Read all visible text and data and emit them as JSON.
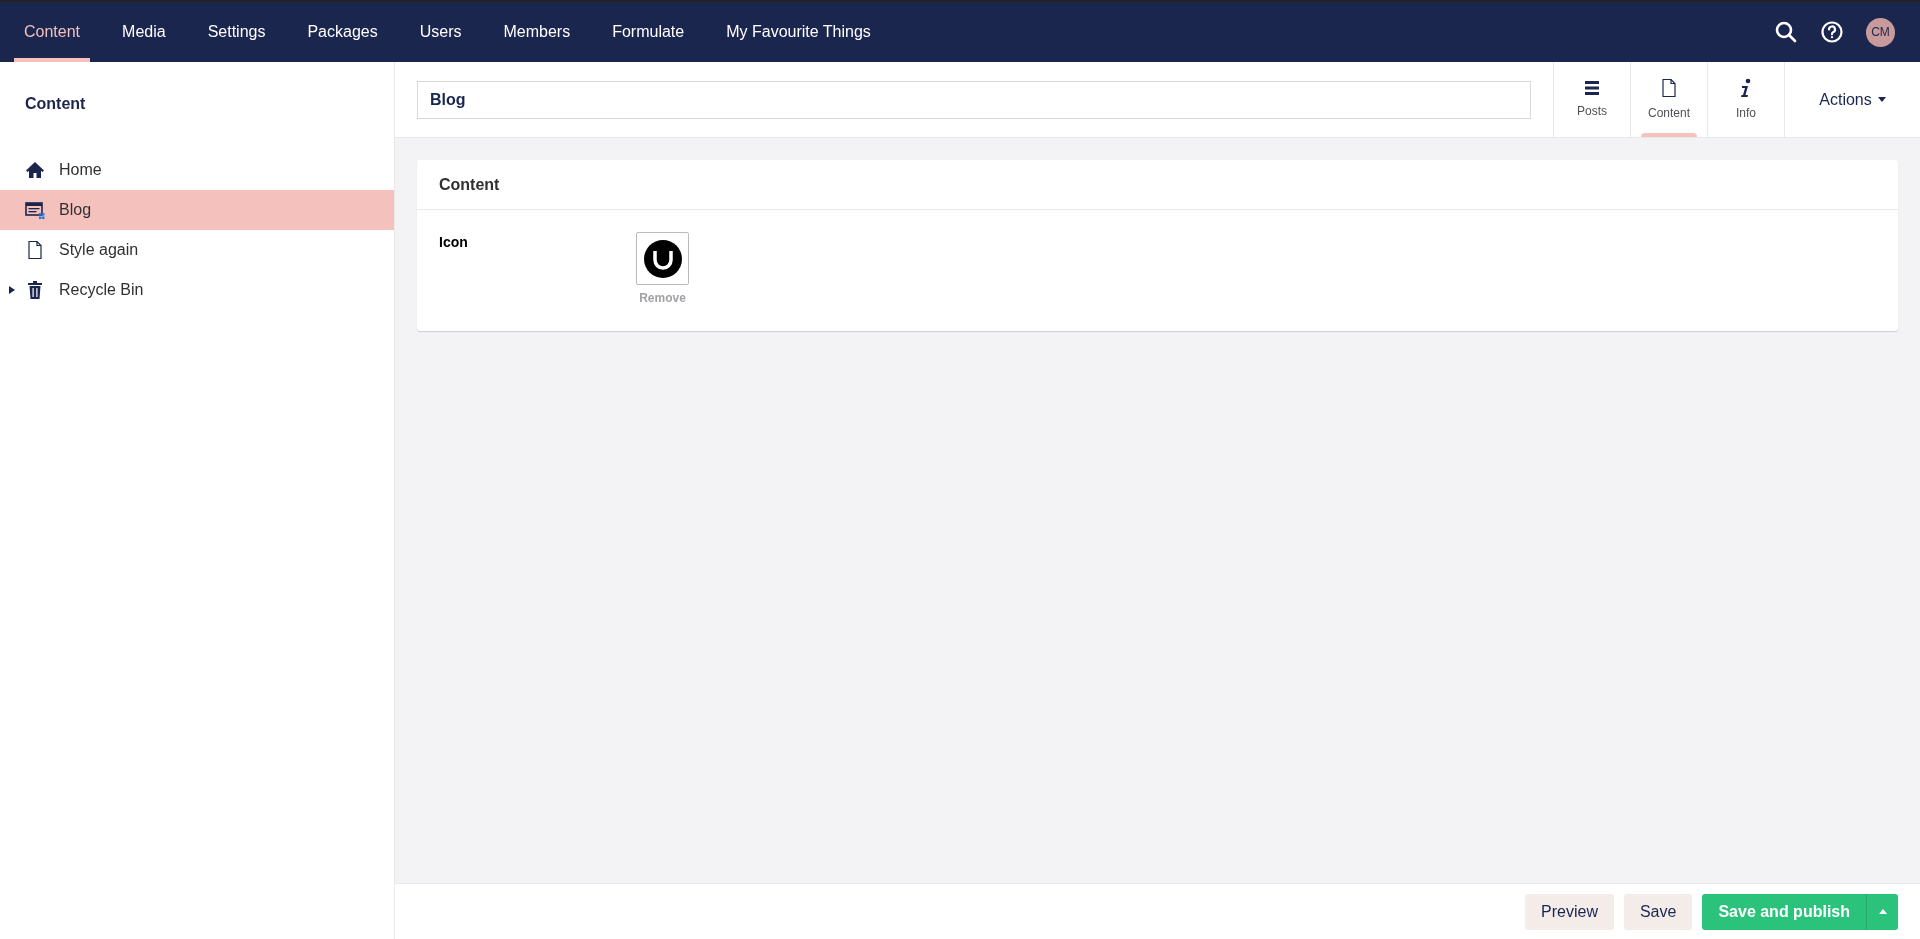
{
  "top_nav": {
    "sections": [
      {
        "label": "Content",
        "selected": true
      },
      {
        "label": "Media",
        "selected": false
      },
      {
        "label": "Settings",
        "selected": false
      },
      {
        "label": "Packages",
        "selected": false
      },
      {
        "label": "Users",
        "selected": false
      },
      {
        "label": "Members",
        "selected": false
      },
      {
        "label": "Formulate",
        "selected": false
      },
      {
        "label": "My Favourite Things",
        "selected": false
      }
    ],
    "avatar": "CM"
  },
  "sidebar": {
    "title": "Content",
    "items": [
      {
        "label": "Home",
        "kind": "home",
        "selected": false,
        "has_children": false
      },
      {
        "label": "Blog",
        "kind": "blog",
        "selected": true,
        "has_children": false
      },
      {
        "label": "Style again",
        "kind": "page",
        "selected": false,
        "has_children": false
      },
      {
        "label": "Recycle Bin",
        "kind": "trash",
        "selected": false,
        "has_children": true
      }
    ]
  },
  "editor": {
    "name": "Blog",
    "apps": [
      {
        "label": "Posts",
        "kind": "list",
        "selected": false
      },
      {
        "label": "Content",
        "kind": "document",
        "selected": true
      },
      {
        "label": "Info",
        "kind": "info",
        "selected": false
      }
    ],
    "actions": "Actions",
    "panel": {
      "title": "Content",
      "properties": [
        {
          "label": "Icon",
          "remove": "Remove"
        }
      ]
    }
  },
  "footer": {
    "buttons": [
      {
        "label": "Preview",
        "kind": "secondary"
      },
      {
        "label": "Save",
        "kind": "secondary"
      },
      {
        "label": "Save and publish",
        "kind": "primary"
      }
    ]
  }
}
